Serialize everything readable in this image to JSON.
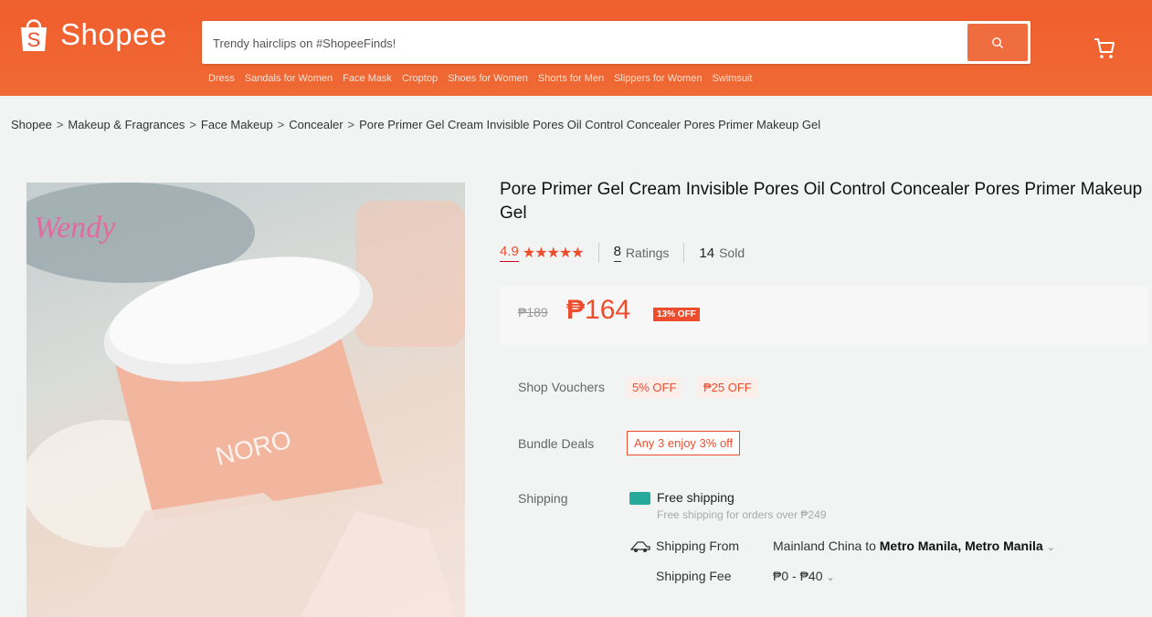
{
  "header": {
    "logo_text": "Shopee",
    "search_placeholder": "Trendy hairclips on #ShopeeFinds!",
    "keywords": [
      "Dress",
      "Sandals for Women",
      "Face Mask",
      "Croptop",
      "Shoes for Women",
      "Shorts for Men",
      "Slippers for Women",
      "Swimsuit"
    ],
    "icons": {
      "search": "search-icon",
      "cart": "cart-icon",
      "logo": "shopee-bag-icon"
    },
    "brand_color": "#ee4d2d"
  },
  "breadcrumb": [
    "Shopee",
    "Makeup & Fragrances",
    "Face Makeup",
    "Concealer",
    "Pore Primer Gel Cream Invisible Pores Oil Control Concealer Pores Primer Makeup Gel"
  ],
  "product": {
    "title": "Pore Primer Gel Cream Invisible Pores Oil Control Concealer Pores Primer Makeup Gel",
    "rating": "4.9",
    "stars": "★★★★★",
    "ratings_count": "8",
    "ratings_label": "Ratings",
    "sold_count": "14",
    "sold_label": "Sold",
    "old_price": "₱189",
    "currency": "₱",
    "new_price": "164",
    "discount": "13% OFF",
    "image_brand": "NORO",
    "image_watermark": "Wendy"
  },
  "details": {
    "vouchers_label": "Shop Vouchers",
    "vouchers": [
      "5% OFF",
      "₱25 OFF"
    ],
    "bundle_label": "Bundle Deals",
    "bundle_value": "Any 3 enjoy 3% off",
    "shipping_label": "Shipping",
    "free_shipping": "Free shipping",
    "free_shipping_sub": "Free shipping for orders over ₱249",
    "ship_from_label": "Shipping From",
    "ship_from": "Mainland China",
    "ship_to_word": "to",
    "ship_to": "Metro Manila, Metro Manila",
    "ship_fee_label": "Shipping Fee",
    "ship_fee": "₱0 - ₱40"
  }
}
